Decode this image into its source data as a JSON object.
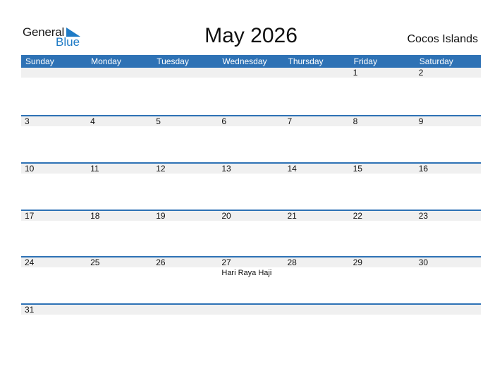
{
  "logo": {
    "general": "General",
    "blue": "Blue"
  },
  "header": {
    "title": "May 2026",
    "country": "Cocos Islands"
  },
  "colors": {
    "accent": "#2e72b5",
    "logo_blue": "#1f7bc6",
    "strip": "#f0f0f0"
  },
  "weekdays": [
    "Sunday",
    "Monday",
    "Tuesday",
    "Wednesday",
    "Thursday",
    "Friday",
    "Saturday"
  ],
  "weeks": [
    {
      "days": [
        "",
        "",
        "",
        "",
        "",
        "1",
        "2"
      ],
      "events": [
        "",
        "",
        "",
        "",
        "",
        "",
        ""
      ]
    },
    {
      "days": [
        "3",
        "4",
        "5",
        "6",
        "7",
        "8",
        "9"
      ],
      "events": [
        "",
        "",
        "",
        "",
        "",
        "",
        ""
      ]
    },
    {
      "days": [
        "10",
        "11",
        "12",
        "13",
        "14",
        "15",
        "16"
      ],
      "events": [
        "",
        "",
        "",
        "",
        "",
        "",
        ""
      ]
    },
    {
      "days": [
        "17",
        "18",
        "19",
        "20",
        "21",
        "22",
        "23"
      ],
      "events": [
        "",
        "",
        "",
        "",
        "",
        "",
        ""
      ]
    },
    {
      "days": [
        "24",
        "25",
        "26",
        "27",
        "28",
        "29",
        "30"
      ],
      "events": [
        "",
        "",
        "",
        "Hari Raya Haji",
        "",
        "",
        ""
      ]
    },
    {
      "days": [
        "31",
        "",
        "",
        "",
        "",
        "",
        ""
      ],
      "events": [
        "",
        "",
        "",
        "",
        "",
        "",
        ""
      ]
    }
  ]
}
